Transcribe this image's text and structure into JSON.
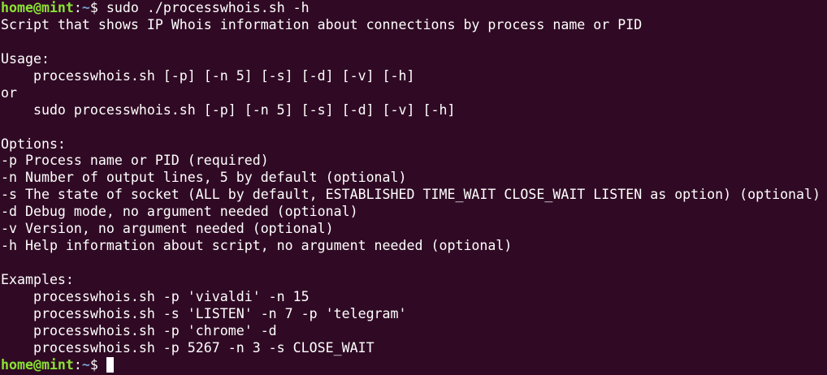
{
  "terminal": {
    "prompt": {
      "user_host": "home@mint",
      "colon": ":",
      "path": "~",
      "symbol": "$ "
    },
    "command": "sudo ./processwhois.sh -h",
    "output_lines": [
      "Script that shows IP Whois information about connections by process name or PID",
      "",
      "Usage:",
      "    processwhois.sh [-p] [-n 5] [-s] [-d] [-v] [-h]",
      "or",
      "    sudo processwhois.sh [-p] [-n 5] [-s] [-d] [-v] [-h]",
      "",
      "Options:",
      "-p Process name or PID (required)",
      "-n Number of output lines, 5 by default (optional)",
      "-s The state of socket (ALL by default, ESTABLISHED TIME_WAIT CLOSE_WAIT LISTEN as option) (optional)",
      "-d Debug mode, no argument needed (optional)",
      "-v Version, no argument needed (optional)",
      "-h Help information about script, no argument needed (optional)",
      "",
      "Examples:",
      "    processwhois.sh -p 'vivaldi' -n 15",
      "    processwhois.sh -s 'LISTEN' -n 7 -p 'telegram'",
      "    processwhois.sh -p 'chrome' -d",
      "    processwhois.sh -p 5267 -n 3 -s CLOSE_WAIT"
    ],
    "colors": {
      "background": "#300a24",
      "text": "#ffffff",
      "prompt_user": "#8ae234",
      "prompt_path": "#729fcf"
    }
  }
}
